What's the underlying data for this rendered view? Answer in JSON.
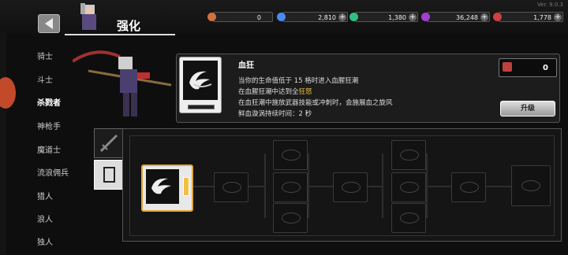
{
  "header": {
    "title": "强化",
    "version": "Ver. 9.0.3"
  },
  "resources": [
    {
      "name": "ticket",
      "value": "0",
      "color": "#d07040"
    },
    {
      "name": "diamond",
      "value": "2,810",
      "color": "#4a8af0"
    },
    {
      "name": "orb",
      "value": "1,380",
      "color": "#30c080"
    },
    {
      "name": "crystal",
      "value": "36,248",
      "color": "#a040d0"
    },
    {
      "name": "potion",
      "value": "1,778",
      "color": "#d04040"
    }
  ],
  "sidebar": {
    "items": [
      {
        "label": "骑士"
      },
      {
        "label": "斗士"
      },
      {
        "label": "杀戮者"
      },
      {
        "label": "神枪手"
      },
      {
        "label": "魔道士"
      },
      {
        "label": "流浪佣兵"
      },
      {
        "label": "猎人"
      },
      {
        "label": "浪人"
      },
      {
        "label": "独人"
      }
    ]
  },
  "skill": {
    "name": "血狂",
    "line1": "当你的生命值低于 15 格时进入血腥狂潮",
    "line2_pre": "在血腥狂潮中达到全",
    "line2_hl": "狂怒",
    "line3": "在血狂潮中施放武器技能或冲刺时，会施展血之旋风",
    "line4": "鲜血漩涡持续时间：2 秒",
    "count": "0",
    "upgrade_label": "升级"
  },
  "colors": {
    "accent": "#e0a63a",
    "highlight": "#f0c040"
  }
}
